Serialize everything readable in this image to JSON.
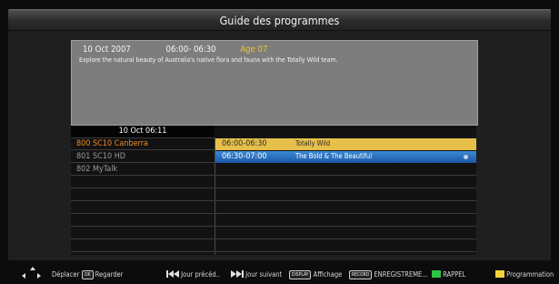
{
  "window": {
    "title": "Guide des programmes"
  },
  "info_panel": {
    "date": "10 Oct 2007",
    "time": "06:00- 06:30",
    "age": "Age 07",
    "description": "Explore the natural beauty of Australia's native flora and fauna with the Totally Wild team."
  },
  "guide": {
    "timebar": "10 Oct  06:11",
    "channels": [
      {
        "label": "800 SC10 Canberra"
      },
      {
        "label": "801 SC10 HD"
      },
      {
        "label": "802 MyTalk"
      }
    ],
    "programs": [
      {
        "time": "06:00-06:30",
        "name": "Totally Wild"
      },
      {
        "time": "06:30-07:00",
        "name": "The Bold & The Beautiful"
      }
    ]
  },
  "footer": {
    "move_label": "Déplacer",
    "ok_key": "OK",
    "watch_label": "Regarder",
    "prev_day_label": "Jour précéd..",
    "next_day_label": "Jour suivant",
    "display_key": "DISPLAY",
    "display_label": "Affichage",
    "record_key": "RECORD",
    "record_label": "ENREGISTREME...",
    "reminder_label": "RAPPEL",
    "schedule_label": "Programmation"
  },
  "colors": {
    "selected_channel": "#f08a2c",
    "current_program": "#e6c04a",
    "focused_program": "#1b58a8",
    "green_key": "#2ec445",
    "yellow_key": "#f2d43a"
  }
}
